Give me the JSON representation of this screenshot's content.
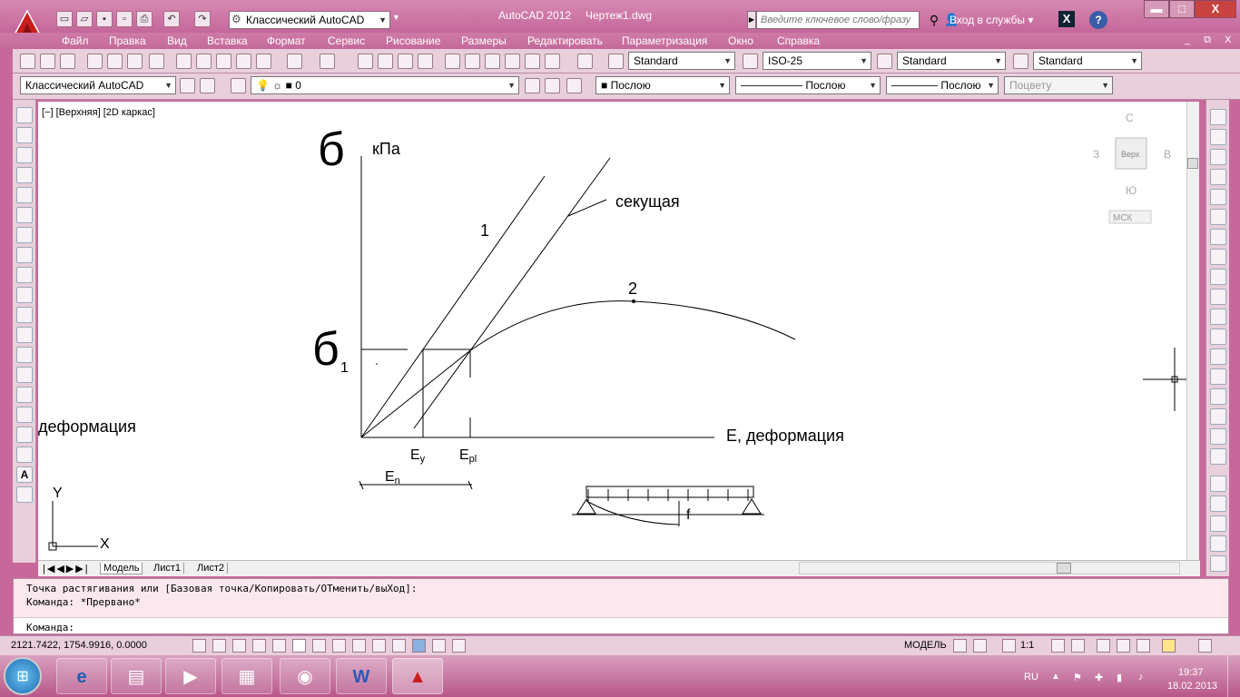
{
  "titlebar": {
    "app_name": "AutoCAD 2012",
    "doc_name": "Чертеж1.dwg",
    "workspace": "Классический AutoCAD",
    "search_placeholder": "Введите ключевое слово/фразу",
    "login": "Вход в службы",
    "window_buttons": {
      "minimize": "▬",
      "maximize": "□",
      "close": "X"
    }
  },
  "menu": [
    "Файл",
    "Правка",
    "Вид",
    "Вставка",
    "Формат",
    "Сервис",
    "Рисование",
    "Размеры",
    "Редактировать",
    "Параметризация",
    "Окно",
    "Справка"
  ],
  "toolbar1": {
    "text_style": "Standard",
    "dim_style": "ISO-25",
    "table_style": "Standard",
    "mleader_style": "Standard"
  },
  "toolbar2": {
    "workspace": "Классический AutoCAD",
    "layer": "0",
    "color": "Послою",
    "linetype": "Послою",
    "lineweight": "Послою",
    "plotstyle": "Поцвету"
  },
  "viewport": {
    "label": "[−] [Верхняя] [2D каркас]"
  },
  "viewcube": {
    "north": "С",
    "south": "Ю",
    "west": "З",
    "east": "В",
    "face": "Верх",
    "ucs": "МСК"
  },
  "drawing": {
    "sigma": "б",
    "kpa": "кПа",
    "secant": "секущая",
    "line1": "1",
    "curve2": "2",
    "sigma1_sub": "1",
    "deform_left": "деформация",
    "x_axis": "Е, деформация",
    "ey": "Е",
    "ey_sub": "у",
    "epl": "Е",
    "epl_sub": "pl",
    "en": "Е",
    "en_sub": "n",
    "f": "f",
    "ucs_y": "Y",
    "ucs_x": "X"
  },
  "tabs": [
    "Модель",
    "Лист1",
    "Лист2"
  ],
  "command": {
    "line1": "Точка растягивания или [Базовая точка/Копировать/ОТменить/выХод]:",
    "line2": "Команда: *Прервано*",
    "prompt": "Команда:"
  },
  "status": {
    "coords": "2121.7422, 1754.9916, 0.0000",
    "model": "МОДЕЛЬ",
    "scale": "1:1"
  },
  "taskbar": {
    "lang": "RU",
    "time": "19:37",
    "date": "18.02.2013"
  }
}
